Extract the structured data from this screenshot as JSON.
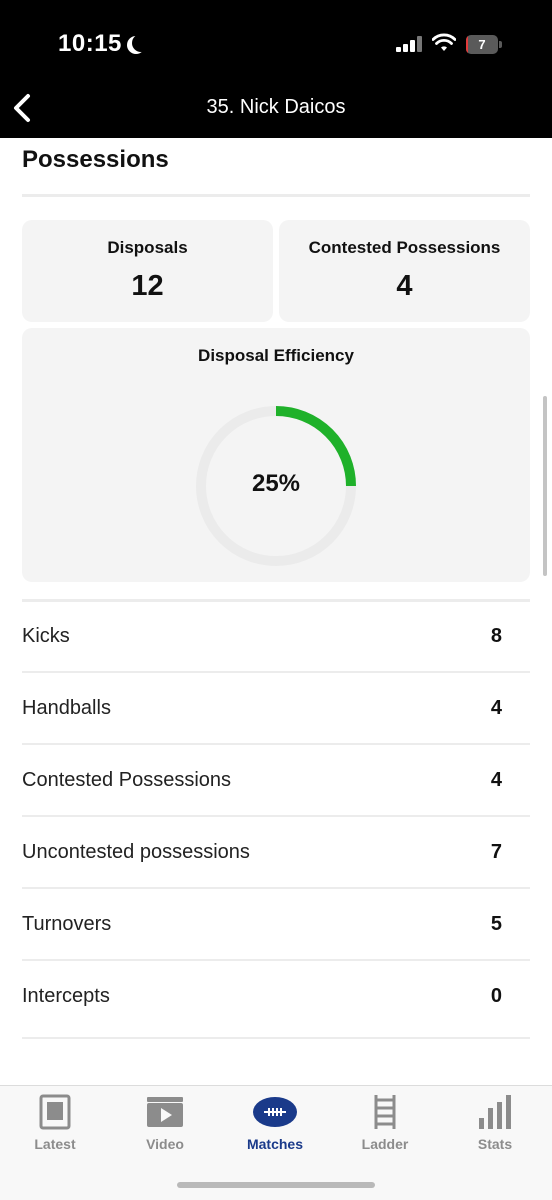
{
  "status_bar": {
    "time": "10:15",
    "battery_level": "7",
    "icons": [
      "moon-icon",
      "signal-icon",
      "wifi-icon",
      "battery-icon"
    ]
  },
  "nav": {
    "title": "35. Nick Daicos",
    "back_icon": "chevron-left-icon"
  },
  "section": {
    "title": "Possessions"
  },
  "cards": {
    "disposals": {
      "label": "Disposals",
      "value": "12"
    },
    "contested": {
      "label": "Contested Possessions",
      "value": "4"
    },
    "efficiency": {
      "label": "Disposal Efficiency",
      "value_text": "25%",
      "fraction": 0.25
    }
  },
  "stats": [
    {
      "label": "Kicks",
      "value": "8"
    },
    {
      "label": "Handballs",
      "value": "4"
    },
    {
      "label": "Contested Possessions",
      "value": "4"
    },
    {
      "label": "Uncontested possessions",
      "value": "7"
    },
    {
      "label": "Turnovers",
      "value": "5"
    },
    {
      "label": "Intercepts",
      "value": "0"
    }
  ],
  "tabs": [
    {
      "label": "Latest",
      "icon": "news-icon",
      "active": false
    },
    {
      "label": "Video",
      "icon": "video-play-icon",
      "active": false
    },
    {
      "label": "Matches",
      "icon": "football-icon",
      "active": true
    },
    {
      "label": "Ladder",
      "icon": "ladder-icon",
      "active": false
    },
    {
      "label": "Stats",
      "icon": "bar-chart-icon",
      "active": false
    }
  ],
  "colors": {
    "accent_green": "#1fb12a",
    "active_tab": "#1a3a8a",
    "inactive_tab": "#8c8c8c",
    "battery_low": "#e23b3b"
  }
}
